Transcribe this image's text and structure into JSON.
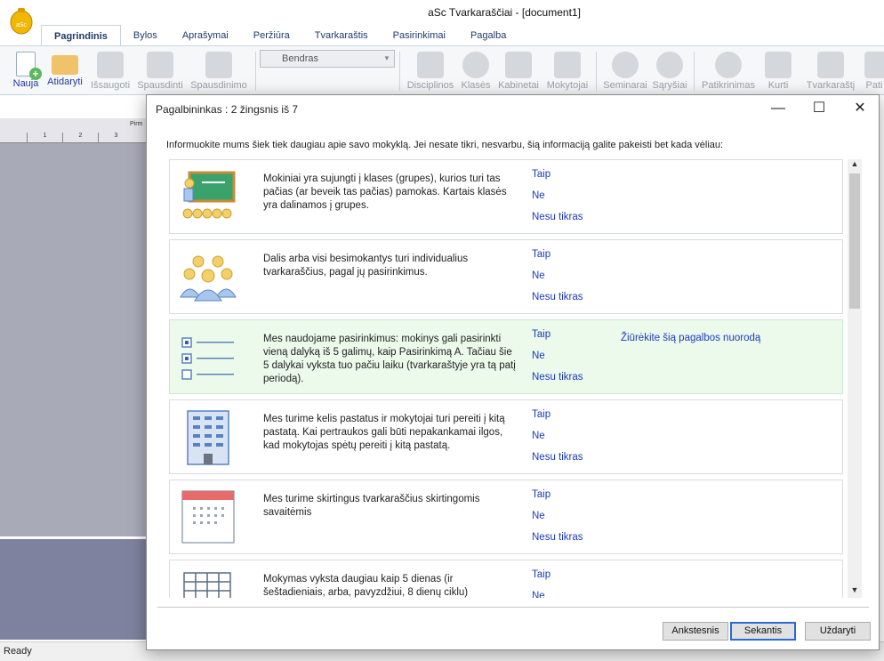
{
  "app": {
    "title": "aSc Tvarkaraščiai  - [document1]",
    "logo_text": "aSc"
  },
  "ribbon": {
    "tabs": [
      "Pagrindinis",
      "Bylos",
      "Aprašymai",
      "Peržiūra",
      "Tvarkaraštis",
      "Pasirinkimai",
      "Pagalba"
    ],
    "buttons": {
      "nauja": "Nauja",
      "atidaryti": "Atidaryti",
      "issaugoti": "Išsaugoti",
      "spausdinti": "Spausdinti",
      "spausdinimo": "Spausdinimo",
      "disciplinos": "Disciplinos",
      "klases": "Klasės",
      "kabinetai": "Kabinetai",
      "mokytojai": "Mokytojai",
      "seminarai": "Seminarai",
      "sarysiai": "Sąryšiai",
      "patikrinimas": "Patikrinimas",
      "kurti": "Kurti",
      "tvarkarastj": "Tvarkaraštį",
      "pati": "Pati"
    },
    "combo_value": "Bendras"
  },
  "grid": {
    "header_text": "Pirm",
    "cols": [
      "1",
      "2",
      "3"
    ]
  },
  "status": {
    "text": "Ready"
  },
  "dialog": {
    "title": "Pagalbininkas : 2 žingsnis iš 7",
    "intro": "Informuokite mums šiek tiek daugiau apie savo mokyklą. Jei nesate tikri, nesvarbu, šią informaciją galite pakeisti bet kada vėliau:",
    "options": {
      "yes": "Taip",
      "no": "Ne",
      "unsure": "Nesu tikras"
    },
    "help_link": "Žiūrėkite šią pagalbos nuorodą",
    "items": [
      {
        "icon": "classroom-icon",
        "text": "Mokiniai yra sujungti į klases (grupes), kurios turi tas pačias (ar beveik tas pačias) pamokas. Kartais klasės yra dalinamos į grupes."
      },
      {
        "icon": "students-group-icon",
        "text": "Dalis arba visi besimokantys turi individualius tvarkaraščius, pagal jų pasirinkimus."
      },
      {
        "icon": "checklist-icon",
        "text": "Mes naudojame pasirinkimus: mokinys gali pasirinkti vieną dalyką iš 5 galimų, kaip Pasirinkimą A. Tačiau šie 5 dalykai vyksta tuo pačiu laiku (tvarkaraštyje yra tą patį periodą)."
      },
      {
        "icon": "building-icon",
        "text": "Mes turime kelis pastatus ir mokytojai turi pereiti į kitą pastatą. Kai pertraukos gali būti nepakankamai ilgos, kad mokytojas spėtų pereiti į kitą pastatą."
      },
      {
        "icon": "calendar-icon",
        "text": "Mes turime skirtingus tvarkaraščius skirtingomis savaitėmis"
      },
      {
        "icon": "grid-days-icon",
        "text": "Mokymas vyksta daugiau kaip 5 dienas (ir šeštadieniais, arba, pavyzdžiui, 8 dienų ciklu)"
      }
    ],
    "buttons": {
      "back": "Ankstesnis",
      "next": "Sekantis",
      "close": "Uždaryti"
    }
  },
  "colors": {
    "accent": "#1a3bbf",
    "highlight_row": "#ecfaec",
    "primary_border": "#2a6ad6"
  }
}
